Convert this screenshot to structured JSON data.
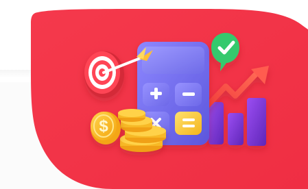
{
  "illustration": {
    "background_color": "#f0384c",
    "calculator": {
      "body_color": "#7e74f4",
      "key_colors": [
        "#8d86ff",
        "#ffd54a"
      ],
      "icons": [
        "plus-icon",
        "minus-icon",
        "times-icon",
        "equals-icon"
      ]
    },
    "badge": {
      "color": "#36c86f",
      "icon": "checkmark-icon"
    },
    "target": {
      "colors": [
        "#f43a4a",
        "#ffffff"
      ]
    },
    "coins": {
      "color": "#f7b928"
    },
    "trend_arrow": {
      "color": "#ff4a44"
    },
    "bars": {
      "color": "#7a3ad8"
    }
  }
}
